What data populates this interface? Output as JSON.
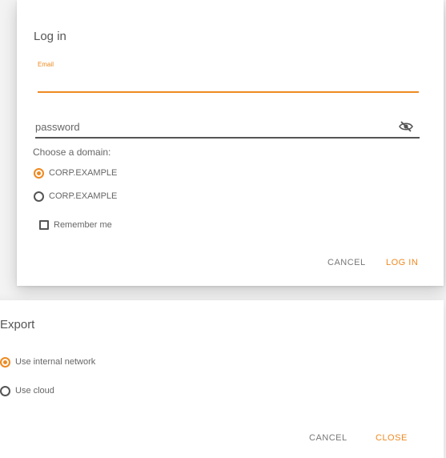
{
  "colors": {
    "accent": "#ee8a22",
    "text": "#555555",
    "background": "#f3f3f3",
    "surface": "#ffffff"
  },
  "login": {
    "title": "Log in",
    "email": {
      "label": "Email",
      "value": ""
    },
    "password": {
      "placeholder": "password",
      "toggle_icon": "eye-slash-icon"
    },
    "domain_label": "Choose a domain:",
    "domains": [
      {
        "label": "CORP.EXAMPLE",
        "checked": true
      },
      {
        "label": "CORP.EXAMPLE",
        "checked": false
      }
    ],
    "remember": {
      "label": "Remember me",
      "checked": false
    },
    "cancel_label": "CANCEL",
    "submit_label": "LOG IN"
  },
  "export": {
    "title": "Export",
    "options": [
      {
        "label": "Use internal network",
        "checked": true
      },
      {
        "label": "Use cloud",
        "checked": false
      }
    ],
    "cancel_label": "CANCEL",
    "submit_label": "CLOSE"
  }
}
